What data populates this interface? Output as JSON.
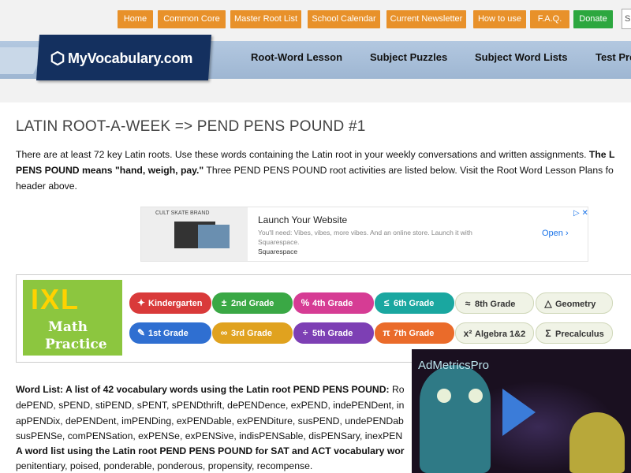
{
  "top_nav": {
    "items": [
      "Home",
      "Common Core",
      "Master Root List",
      "School Calendar",
      "Current Newsletter",
      "How to use",
      "F.A.Q.",
      "Donate"
    ],
    "search_placeholder": "S"
  },
  "header": {
    "logo_text": "MyVocabulary.com",
    "nav": [
      "Root-Word Lesson",
      "Subject Puzzles",
      "Subject Word Lists",
      "Test Pre"
    ]
  },
  "page": {
    "title": "LATIN ROOT-A-WEEK => PEND PENS POUND #1",
    "intro_line1": "There are at least 72 key Latin roots. Use these words containing the Latin root in your weekly conversations and written assignments.",
    "intro_line1_bold": "The L",
    "intro_line2_bold": "PENS POUND means \"hand, weigh, pay.\"",
    "intro_line2": "Three PEND PENS POUND root activities are listed below. Visit the Root Word Lesson Plans fo",
    "intro_line3": "header above."
  },
  "ad": {
    "brand": "CULT SKATE BRAND",
    "title": "Launch Your Website",
    "body": "You'll need: Vibes, vibes, more vibes. And an online store. Launch it with Squarespace.",
    "sponsor": "Squarespace",
    "cta": "Open",
    "close_icons": "▷ ✕"
  },
  "ixl": {
    "logo": "IXL",
    "subtitle1": "Math",
    "subtitle2": "Practice",
    "grades": [
      {
        "label": "Kindergarten",
        "icon": "✦"
      },
      {
        "label": "2nd Grade",
        "icon": "±"
      },
      {
        "label": "4th Grade",
        "icon": "%"
      },
      {
        "label": "6th Grade",
        "icon": "≤"
      },
      {
        "label": "8th Grade",
        "icon": "≈"
      },
      {
        "label": "Geometry",
        "icon": "△"
      },
      {
        "label": "1st Grade",
        "icon": "✎"
      },
      {
        "label": "3rd Grade",
        "icon": "∞"
      },
      {
        "label": "5th Grade",
        "icon": "÷"
      },
      {
        "label": "7th Grade",
        "icon": "π"
      },
      {
        "label": "Algebra 1&2",
        "icon": "x²"
      },
      {
        "label": "Precalculus",
        "icon": "Σ"
      }
    ]
  },
  "word_list": {
    "heading": "Word List: A list of 42 vocabulary words using the Latin root PEND PENS POUND:",
    "line1_tail": "Ro",
    "line2": "dePEND, sPEND, stiPEND, sPENT, sPENDthrift, dePENDence, exPEND, indePENDent, in",
    "line3": "apPENDix, dePENDent, imPENDing, exPENDable, exPENDiture, susPEND, undePENDab",
    "line4": "susPENSe, comPENSation, exPENSe, exPENSive, indisPENSable, disPENSary, inexPEN",
    "line5_bold": "A word list using the Latin root PEND PENS POUND for SAT and ACT vocabulary wor",
    "line6": "penitentiary, poised, ponderable, ponderous, propensity, recompense."
  },
  "video_ad": {
    "brand": "AdMetricsPro"
  },
  "colors": {
    "nav_orange": "#e8912a",
    "donate_green": "#2ca73f",
    "logo_navy": "#14305f",
    "stripe_blue": "#a8bfd9"
  }
}
